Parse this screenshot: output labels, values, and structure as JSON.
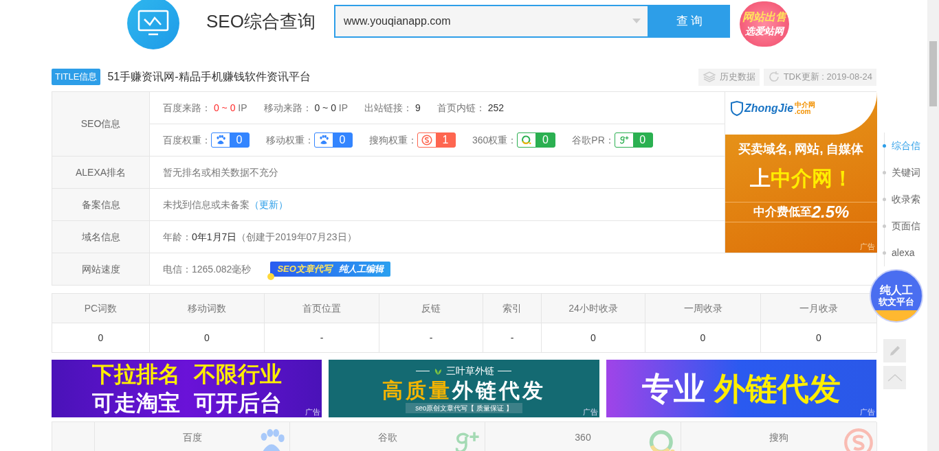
{
  "header": {
    "title": "SEO综合查询",
    "search": {
      "value": "www.youqianapp.com"
    },
    "search_button": "查 询",
    "promo": {
      "line1": "网站出售",
      "line2": "选爱站网"
    }
  },
  "title_info": {
    "badge": "TITLE信息",
    "title": "51手赚资讯网-精品手机赚钱软件资讯平台",
    "history_button": "历史数据",
    "tdk_update": "TDK更新 : 2019-08-24"
  },
  "seo_table": {
    "seo_info": {
      "label": "SEO信息",
      "traffic": [
        {
          "label": "百度来路：",
          "value": "0 ~ 0",
          "unit": "IP",
          "highlight": true
        },
        {
          "label": "移动来路：",
          "value": "0 ~ 0",
          "unit": "IP",
          "highlight": false
        },
        {
          "label": "出站链接：",
          "value": "9",
          "highlight": false
        },
        {
          "label": "首页内链：",
          "value": "252",
          "highlight": false
        }
      ],
      "weights": [
        {
          "label": "百度权重：",
          "kind": "baidu",
          "value": "0",
          "color": "#3385ff"
        },
        {
          "label": "移动权重：",
          "kind": "mobile",
          "value": "0",
          "color": "#3385ff"
        },
        {
          "label": "搜狗权重：",
          "kind": "sogou",
          "value": "1",
          "color": "#fe6650"
        },
        {
          "label": "360权重：",
          "kind": "ring",
          "value": "0",
          "color": "#2bb051"
        },
        {
          "label": "谷歌PR：",
          "kind": "google",
          "value": "0",
          "color": "#2bb051"
        }
      ]
    },
    "alexa": {
      "label": "ALEXA排名",
      "text": "暂无排名或相关数据不充分"
    },
    "beian": {
      "label": "备案信息",
      "text": "未找到信息或未备案",
      "link": "（更新）"
    },
    "domain": {
      "label": "域名信息",
      "prefix": "年龄：",
      "age": "0年1月7日",
      "created": "（创建于2019年07月23日）"
    },
    "speed": {
      "label": "网站速度",
      "text": "电信：1265.082毫秒",
      "ad_part1": "SEO文章代写",
      "ad_part2": "纯人工编辑"
    }
  },
  "side_ad": {
    "brand": "ZhongJie",
    "brand_suffix": ".com",
    "brand_cn": "中介网",
    "line1": "买卖域名, 网站, 自媒体",
    "line2_a": "上",
    "line2_b": "中介网！",
    "line3_a": "中介费低至",
    "line3_b": "2.5%",
    "ad_mark": "广告"
  },
  "stats": {
    "columns": [
      "PC词数",
      "移动词数",
      "首页位置",
      "反链",
      "索引",
      "24小时收录",
      "一周收录",
      "一月收录"
    ],
    "values": [
      "0",
      "0",
      "-",
      "-",
      "-",
      "0",
      "0",
      "0"
    ]
  },
  "banners": [
    {
      "kind": "purple",
      "lines": [
        "下拉排名",
        "不限行业",
        "可走淘宝",
        "可开后台"
      ],
      "ad_mark": "广告"
    },
    {
      "kind": "teal",
      "lines": [
        "三叶草外链",
        "高质量",
        "外链代发",
        "seo原创文章代写【 质量保证 】"
      ],
      "ad_mark": "广告"
    },
    {
      "kind": "blue",
      "lines": [
        "专业",
        "外链代发"
      ],
      "ad_mark": "广告"
    }
  ],
  "engines": [
    {
      "label": "百度",
      "kind": "baidu"
    },
    {
      "label": "谷歌",
      "kind": "google"
    },
    {
      "label": "360",
      "kind": "ring"
    },
    {
      "label": "搜狗",
      "kind": "sogou"
    }
  ],
  "side_nav": [
    {
      "label": "综合信",
      "selected": true
    },
    {
      "label": "关键词",
      "selected": false
    },
    {
      "label": "收录索",
      "selected": false
    },
    {
      "label": "页面信",
      "selected": false
    },
    {
      "label": "alexa",
      "selected": false
    }
  ],
  "float_badge": {
    "line1": "纯人工",
    "line2": "软文平台"
  }
}
